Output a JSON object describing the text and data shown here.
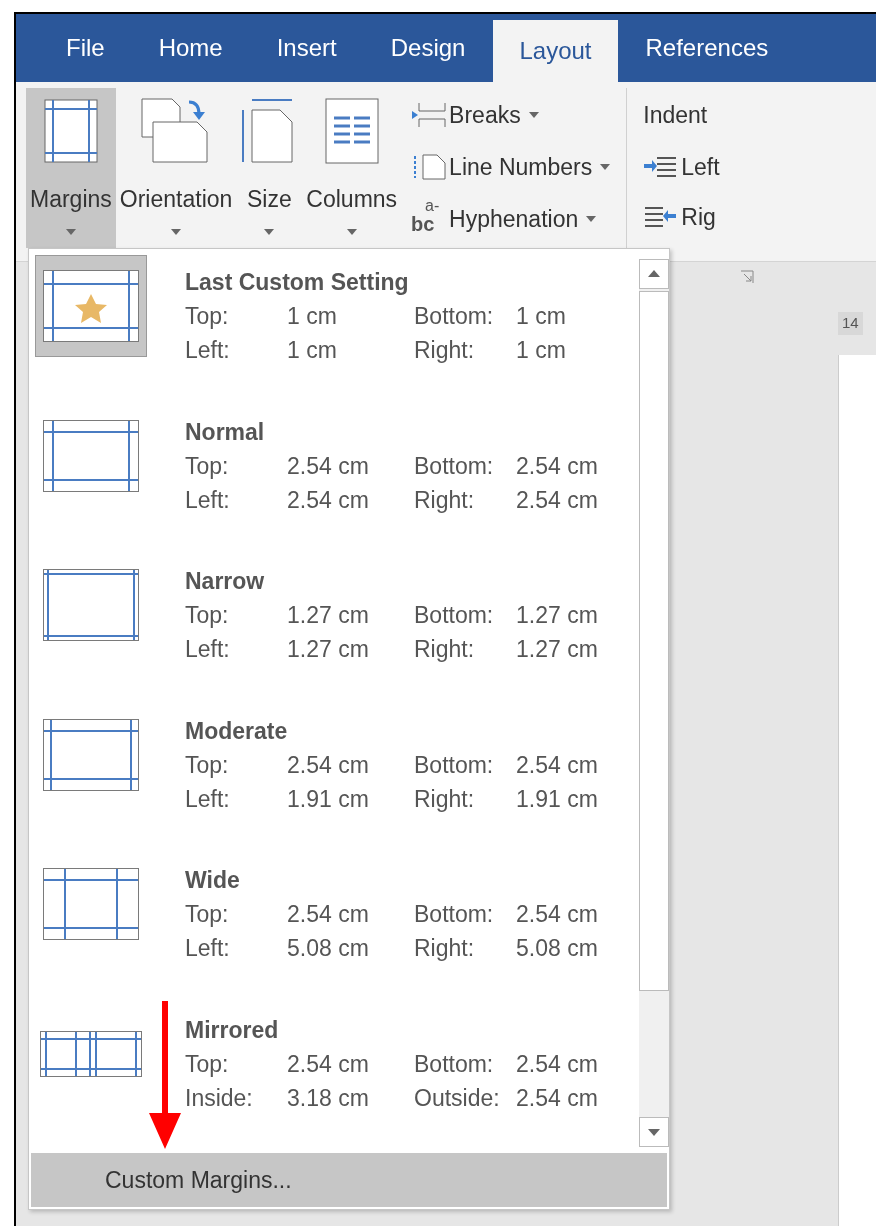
{
  "tabs": [
    {
      "label": "File",
      "selected": false
    },
    {
      "label": "Home",
      "selected": false
    },
    {
      "label": "Insert",
      "selected": false
    },
    {
      "label": "Design",
      "selected": false
    },
    {
      "label": "Layout",
      "selected": true
    },
    {
      "label": "References",
      "selected": false
    }
  ],
  "ribbon": {
    "big_buttons": [
      {
        "kind": "margins",
        "label": "Margins",
        "selected": true
      },
      {
        "kind": "orientation",
        "label": "Orientation",
        "selected": false
      },
      {
        "kind": "size",
        "label": "Size",
        "selected": false
      },
      {
        "kind": "columns",
        "label": "Columns",
        "selected": false
      }
    ],
    "small_buttons": [
      {
        "kind": "breaks",
        "label": "Breaks"
      },
      {
        "kind": "line_numbers",
        "label": "Line Numbers"
      },
      {
        "kind": "hyphenation",
        "label": "Hyphenation",
        "icon_text": "a-",
        "icon_text_2": "bc"
      }
    ],
    "indent": {
      "title": "Indent",
      "items": [
        {
          "kind": "left",
          "label": "Left"
        },
        {
          "kind": "right",
          "label": "Rig"
        }
      ]
    }
  },
  "ruler": {
    "label": "14"
  },
  "margins_menu": {
    "items": [
      {
        "name": "Last Custom Setting",
        "kind": "star",
        "selected": true,
        "rows": [
          [
            {
              "label": "Top:",
              "value": "1 cm"
            },
            {
              "label": "Bottom:",
              "value": "1 cm"
            }
          ],
          [
            {
              "label": "Left:",
              "value": "1 cm"
            },
            {
              "label": "Right:",
              "value": "1 cm"
            }
          ]
        ]
      },
      {
        "name": "Normal",
        "kind": "normal",
        "selected": false,
        "rows": [
          [
            {
              "label": "Top:",
              "value": "2.54 cm"
            },
            {
              "label": "Bottom:",
              "value": "2.54 cm"
            }
          ],
          [
            {
              "label": "Left:",
              "value": "2.54 cm"
            },
            {
              "label": "Right:",
              "value": "2.54 cm"
            }
          ]
        ]
      },
      {
        "name": "Narrow",
        "kind": "narrow",
        "selected": false,
        "rows": [
          [
            {
              "label": "Top:",
              "value": "1.27 cm"
            },
            {
              "label": "Bottom:",
              "value": "1.27 cm"
            }
          ],
          [
            {
              "label": "Left:",
              "value": "1.27 cm"
            },
            {
              "label": "Right:",
              "value": "1.27 cm"
            }
          ]
        ]
      },
      {
        "name": "Moderate",
        "kind": "moderate",
        "selected": false,
        "rows": [
          [
            {
              "label": "Top:",
              "value": "2.54 cm"
            },
            {
              "label": "Bottom:",
              "value": "2.54 cm"
            }
          ],
          [
            {
              "label": "Left:",
              "value": "1.91 cm"
            },
            {
              "label": "Right:",
              "value": "1.91 cm"
            }
          ]
        ]
      },
      {
        "name": "Wide",
        "kind": "wide",
        "selected": false,
        "rows": [
          [
            {
              "label": "Top:",
              "value": "2.54 cm"
            },
            {
              "label": "Bottom:",
              "value": "2.54 cm"
            }
          ],
          [
            {
              "label": "Left:",
              "value": "5.08 cm"
            },
            {
              "label": "Right:",
              "value": "5.08 cm"
            }
          ]
        ]
      },
      {
        "name": "Mirrored",
        "kind": "mirrored",
        "selected": false,
        "rows": [
          [
            {
              "label": "Top:",
              "value": "2.54 cm"
            },
            {
              "label": "Bottom:",
              "value": "2.54 cm"
            }
          ],
          [
            {
              "label": "Inside:",
              "value": "3.18 cm"
            },
            {
              "label": "Outside:",
              "value": "2.54 cm"
            }
          ]
        ]
      }
    ],
    "footer": "Custom Margins..."
  }
}
